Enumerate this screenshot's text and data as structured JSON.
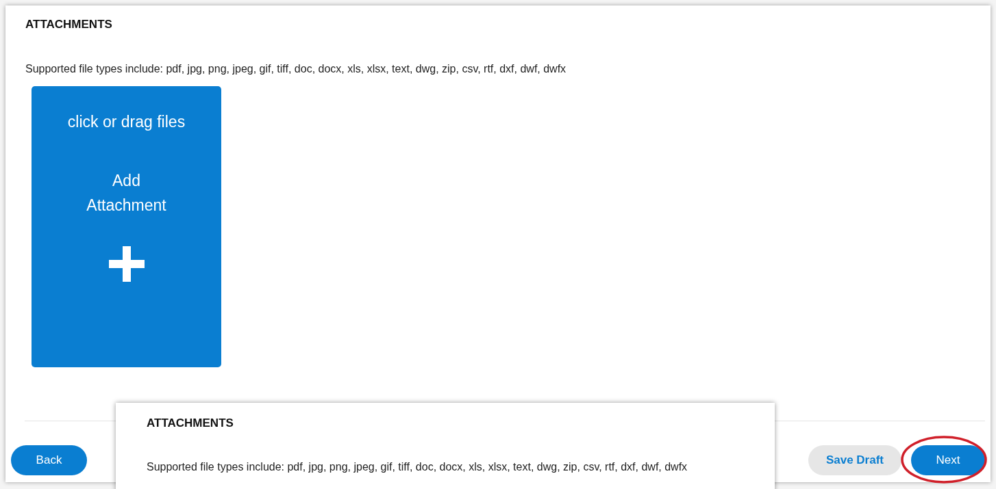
{
  "section": {
    "title": "ATTACHMENTS",
    "supported_types": "Supported file types include: pdf, jpg, png, jpeg, gif, tiff, doc, docx, xls, xlsx, text, dwg, zip, csv, rtf, dxf, dwf, dwfx"
  },
  "dropzone": {
    "hint": "click or drag files",
    "label": "Add Attachment"
  },
  "footer": {
    "buttons": [
      {
        "label": "Back",
        "kind": "primary"
      },
      {
        "label": "Save Draft",
        "kind": "secondary"
      },
      {
        "label": "Next",
        "kind": "primary",
        "highlighted": true
      }
    ]
  },
  "callout": {
    "title": "ATTACHMENTS",
    "supported_types": "Supported file types include: pdf, jpg, png, jpeg, gif, tiff, doc, docx, xls, xlsx, text, dwg, zip, csv, rtf, dxf, dwf, dwfx"
  }
}
